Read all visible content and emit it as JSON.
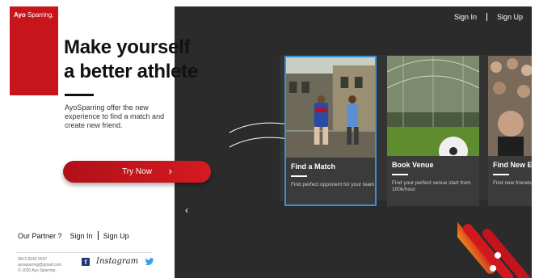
{
  "brand": {
    "logo_text_bold": "Ayo",
    "logo_text": " Sparring."
  },
  "top_nav": {
    "sign_in": "Sign In",
    "sign_up": "Sign Up"
  },
  "hero": {
    "headline_line1": "Make yourself",
    "headline_line2": "a better athlete",
    "description": "AyoSparring offer the new experience to find a match and create new friend.",
    "cta_label": "Try Now",
    "cta_arrow": "›"
  },
  "bottom_nav": {
    "partner": "Our Partner ?",
    "sign_in": "Sign In",
    "sign_up": "Sign Up"
  },
  "contact": {
    "phone": "0813 8342 5597",
    "email": "ayosparring@gmail.com",
    "copyright": "© 2020 Ayo Sparring"
  },
  "socials": {
    "facebook": "f",
    "instagram": "Instagram"
  },
  "cards": [
    {
      "title": "Find a Match",
      "text": "Find perfect opponent for your team"
    },
    {
      "title": "Book Venue",
      "text": "Find your perfect venue start from 100k/hour"
    },
    {
      "title": "Find New Ex",
      "text": "Find new friends, and adventure"
    }
  ],
  "carousel": {
    "prev_arrow": "‹"
  },
  "colors": {
    "brand_red": "#c8141b",
    "dark_bg": "#2b2b2b",
    "card_selected": "#3b8fd9"
  },
  "icons": [
    "facebook-icon",
    "instagram-icon",
    "twitter-icon",
    "chevron-left-icon",
    "chevron-right-icon"
  ]
}
